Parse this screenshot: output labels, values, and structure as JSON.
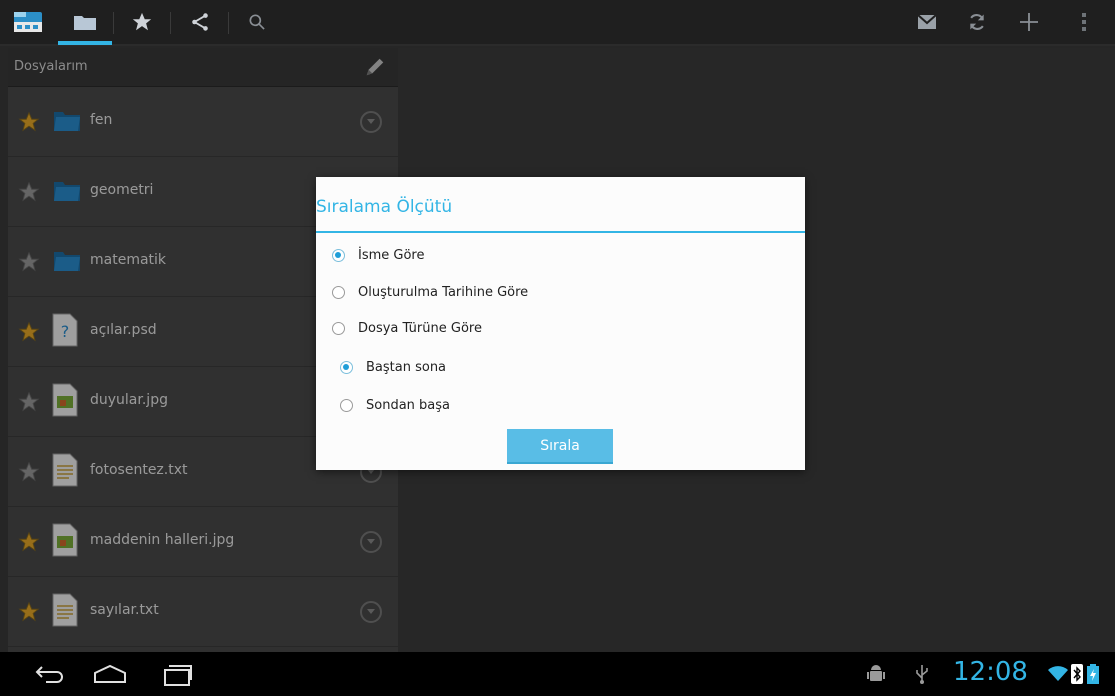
{
  "app": {
    "accent": "#33b5e5"
  },
  "actionbar": {
    "tabs": [
      {
        "icon": "app-logo-icon"
      },
      {
        "icon": "folder-icon",
        "selected": true
      },
      {
        "icon": "star-icon"
      },
      {
        "icon": "share-icon"
      },
      {
        "icon": "search-icon"
      }
    ],
    "actions": [
      "mail-icon",
      "refresh-icon",
      "add-icon",
      "overflow-menu-icon"
    ]
  },
  "pane": {
    "title": "Dosyalarım",
    "items": [
      {
        "name": "fen",
        "type": "folder",
        "starred": true
      },
      {
        "name": "geometri",
        "type": "folder",
        "starred": false
      },
      {
        "name": "matematik",
        "type": "folder",
        "starred": false
      },
      {
        "name": "açılar.psd",
        "type": "unknown-file",
        "starred": true
      },
      {
        "name": "duyular.jpg",
        "type": "image-file",
        "starred": false
      },
      {
        "name": "fotosentez.txt",
        "type": "text-file",
        "starred": false
      },
      {
        "name": "maddenin halleri.jpg",
        "type": "image-file",
        "starred": true
      },
      {
        "name": "sayılar.txt",
        "type": "text-file",
        "starred": true
      }
    ]
  },
  "dialog": {
    "title": "Sıralama Ölçütü",
    "sort_by": [
      {
        "label": "İsme Göre",
        "checked": true
      },
      {
        "label": "Oluşturulma Tarihine Göre",
        "checked": false
      },
      {
        "label": "Dosya Türüne Göre",
        "checked": false
      }
    ],
    "order": [
      {
        "label": "Baştan sona",
        "checked": true
      },
      {
        "label": "Sondan başa",
        "checked": false
      }
    ],
    "button": "Sırala"
  },
  "statusbar": {
    "time": "12:08"
  }
}
